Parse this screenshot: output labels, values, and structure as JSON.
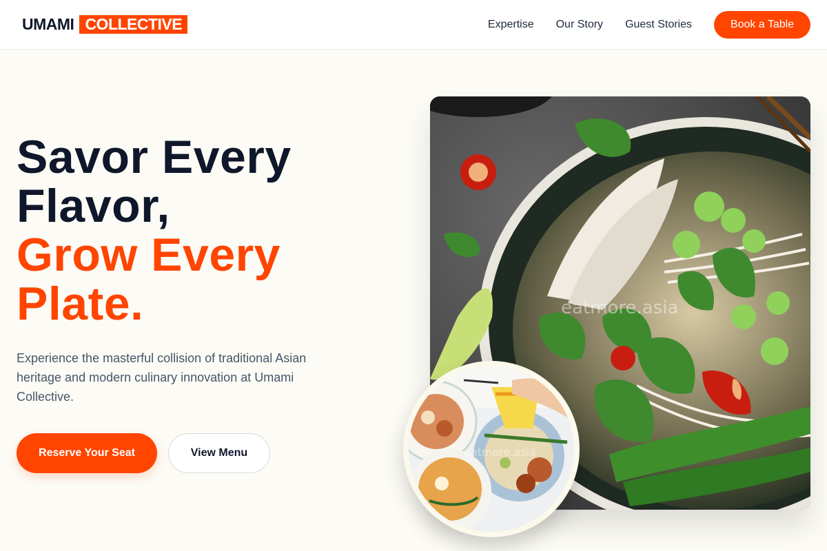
{
  "brand": {
    "name_part1": "UMAMI",
    "name_part2": "COLLECTIVE"
  },
  "nav": {
    "links": [
      "Expertise",
      "Our Story",
      "Guest Stories"
    ],
    "cta": "Book a Table"
  },
  "hero": {
    "title_line1": "Savor Every",
    "title_line2": "Flavor,",
    "title_line3": "Grow Every",
    "title_line4": "Plate.",
    "subtitle": "Experience the masterful collision of traditional Asian heritage and modern culinary innovation at Umami Collective.",
    "primary_button": "Reserve Your Seat",
    "secondary_button": "View Menu"
  },
  "images": {
    "main_watermark": "eatmore.asia",
    "inset_watermark": "eatmore.asia"
  },
  "colors": {
    "accent": "#ff4500",
    "dark": "#0f172a",
    "background": "#fcfbf5"
  }
}
